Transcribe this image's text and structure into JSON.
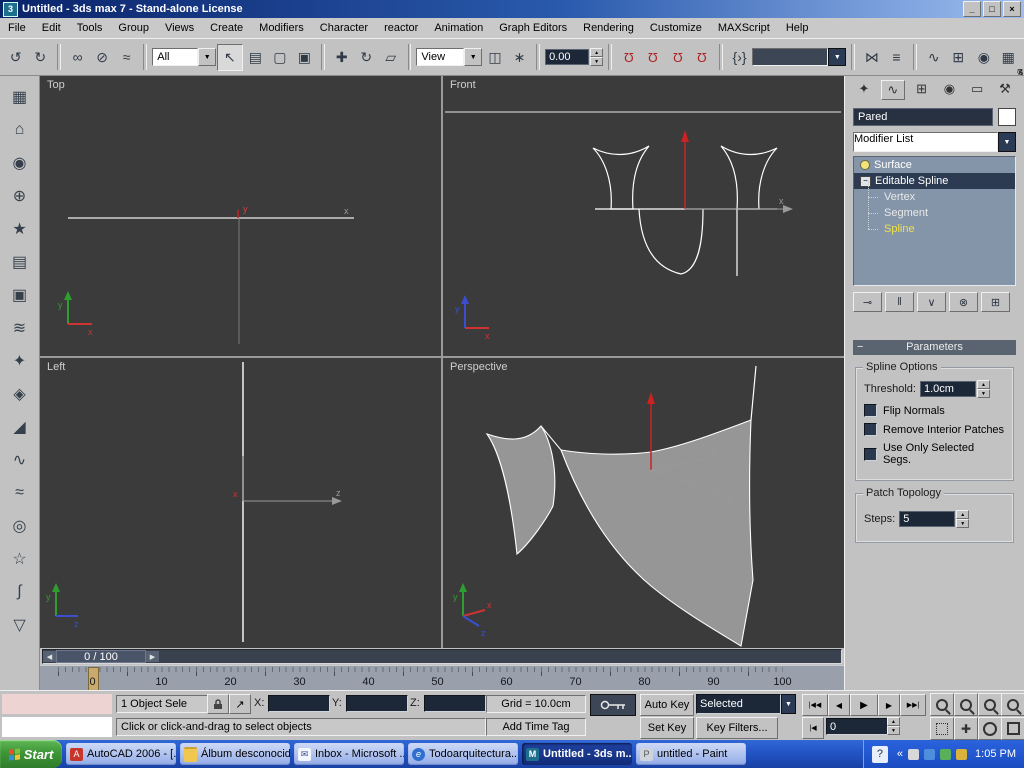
{
  "window": {
    "title": "Untitled - 3ds max 7  - Stand-alone License"
  },
  "icons": {
    "app": "3",
    "min": "_",
    "max": "□",
    "close": "×",
    "undo": "↺",
    "redo": "↻",
    "link": "∞",
    "unlink": "⊘",
    "bind": "≈",
    "select": "↖",
    "select_by_name": "▤",
    "region": "▢",
    "window_sel": "▣",
    "move": "✚",
    "rotate": "↻",
    "scale": "▱",
    "use_center": "◫",
    "manipulate": "∗",
    "magnet": "Ω",
    "snap3": "3",
    "snap_angle": "∠",
    "snap_percent": "%",
    "snap_spin": "↕",
    "kbd": "{›}",
    "mirror": "⋈",
    "align": "≡",
    "curve": "∿",
    "schematic": "⊞",
    "material": "◉",
    "render": "▦",
    "dropdown": "▼",
    "up": "▲",
    "down": "▼",
    "tab_create": "✦",
    "tab_modify": "∿",
    "tab_hierarchy": "⊞",
    "tab_motion": "◉",
    "tab_display": "▭",
    "tab_utilities": "⚒",
    "pin": "⊸",
    "show_end": "‖",
    "unique": "∨",
    "remove": "⊗",
    "config": "⊞",
    "goto_start": "|◀◀",
    "prev_frame": "◀",
    "play": "▶",
    "next_frame": "▶",
    "goto_end": "▶▶|",
    "key_mode": "|◀",
    "left_arrow": "◀",
    "right_arrow": "▶",
    "chevron": "«",
    "tray_btn": "?",
    "expand_minus": "−",
    "offset_mode": "↗"
  },
  "menu": {
    "items": [
      "File",
      "Edit",
      "Tools",
      "Group",
      "Views",
      "Create",
      "Modifiers",
      "Character",
      "reactor",
      "Animation",
      "Graph Editors",
      "Rendering",
      "Customize",
      "MAXScript",
      "Help"
    ]
  },
  "toolbar": {
    "filter": "All",
    "coord": "View",
    "spinner": "0.00"
  },
  "left_toolbar": {
    "icons": [
      "▦",
      "⌂",
      "◉",
      "⊕",
      "★",
      "▤",
      "▣",
      "≋",
      "✦",
      "◈",
      "◢",
      "∿",
      "≈",
      "◎",
      "☆",
      "∫",
      "▽"
    ]
  },
  "viewports": {
    "top": "Top",
    "front": "Front",
    "left": "Left",
    "perspective": "Perspective"
  },
  "panel": {
    "object_name": "Pared",
    "modifier_list": "Modifier List",
    "stack": {
      "surface": "Surface",
      "editable": "Editable Spline",
      "vertex": "Vertex",
      "segment": "Segment",
      "spline": "Spline"
    },
    "rollout": "Parameters",
    "group1": "Spline Options",
    "threshold_label": "Threshold:",
    "threshold_value": "1.0cm",
    "cb1": "Flip Normals",
    "cb2": "Remove Interior Patches",
    "cb3": "Use Only Selected Segs.",
    "group2": "Patch Topology",
    "steps_label": "Steps:",
    "steps_value": "5"
  },
  "timeline": {
    "slider": "0 / 100",
    "ticks": [
      "0",
      "10",
      "20",
      "30",
      "40",
      "50",
      "60",
      "70",
      "80",
      "90",
      "100"
    ]
  },
  "status": {
    "selection": "1 Object Sele",
    "x": "X:",
    "y": "Y:",
    "z": "Z:",
    "grid": "Grid = 10.0cm",
    "prompt": "Click or click-and-drag to select objects",
    "time_tag": "Add Time Tag",
    "auto_key": "Auto Key",
    "set_key": "Set Key",
    "key_filter_set": "Selected",
    "key_filters": "Key Filters...",
    "frame": "0"
  },
  "taskbar": {
    "start": "Start",
    "tasks": [
      {
        "label": "AutoCAD 2006 - [..."
      },
      {
        "label": "Álbum desconocid..."
      },
      {
        "label": "Inbox - Microsoft ..."
      },
      {
        "label": "Todoarquitectura...."
      },
      {
        "label": "Untitled - 3ds m..."
      },
      {
        "label": "untitled - Paint"
      }
    ],
    "clock": "1:05 PM"
  }
}
